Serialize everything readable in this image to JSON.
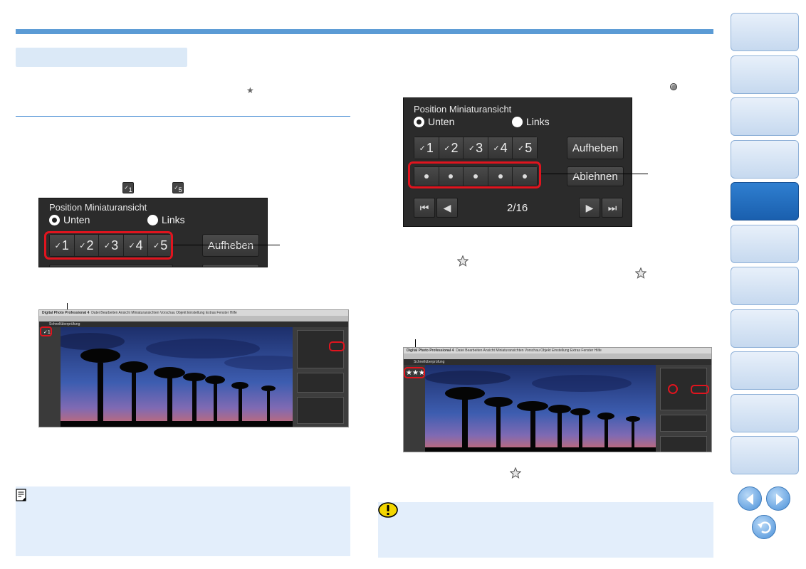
{
  "icons": {
    "rating_star": "star-icon",
    "check_mark": "check-mark-icon",
    "reject_dot": "reject-dot-icon",
    "memo": "memo-icon",
    "caution": "caution-icon",
    "prev": "left-arrow-icon",
    "next": "right-arrow-icon",
    "back": "return-icon"
  },
  "badges": {
    "check_first": "1",
    "check_last": "5"
  },
  "panel_left": {
    "title": "Position Miniaturansicht",
    "radio_bottom": "Unten",
    "radio_left": "Links",
    "check_buttons": [
      "1",
      "2",
      "3",
      "4",
      "5"
    ],
    "clear_button": "Aufheben"
  },
  "panel_right": {
    "title": "Position Miniaturansicht",
    "radio_bottom": "Unten",
    "radio_left": "Links",
    "check_buttons": [
      "1",
      "2",
      "3",
      "4",
      "5"
    ],
    "clear_button": "Aufheben",
    "reject_button": "Ablehnen",
    "counter": "2/16"
  },
  "screenshot_left": {
    "app_name": "Digital Photo Professional 4",
    "menu_items": "Datei  Bearbeiten  Ansicht  Miniaturansichten  Vorschau  Objekt  Einstellung  Extras  Fenster  Hilfe",
    "toolbar_label": "Schnellüberprüfung",
    "check_badge": "1"
  },
  "screenshot_right": {
    "app_name": "Digital Photo Professional 4",
    "menu_items": "Datei  Bearbeiten  Ansicht  Miniaturansichten  Vorschau  Objekt  Einstellung  Extras  Fenster  Hilfe",
    "toolbar_label": "Schnellüberprüfung",
    "rating_badge": "★★★"
  },
  "colors": {
    "accent_blue": "#5b9bd5",
    "highlight_red": "#e0141e",
    "panel_dark": "#2b2b2b",
    "note_bg": "#e3eefb"
  }
}
